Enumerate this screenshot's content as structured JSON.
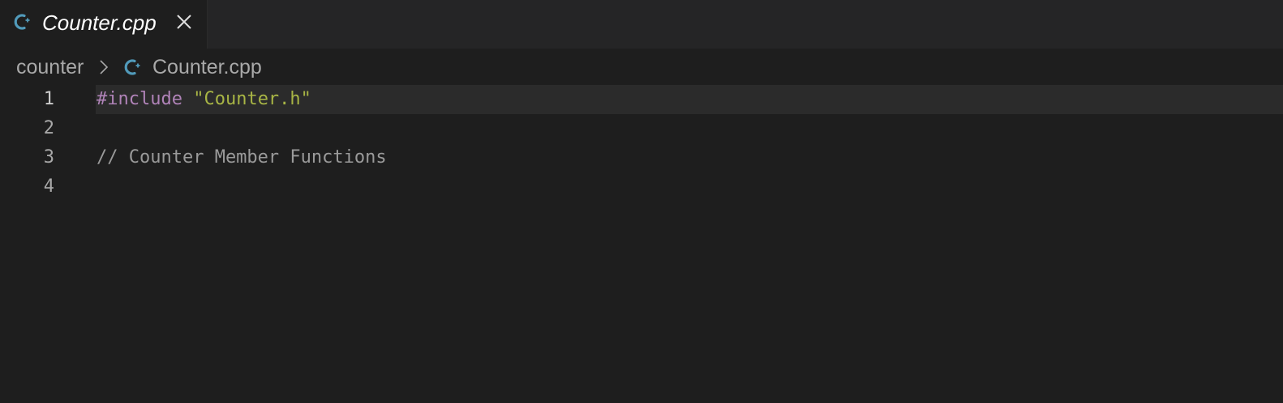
{
  "tab": {
    "label": "Counter.cpp",
    "icon": "cpp-file-icon",
    "close_icon": "close-icon"
  },
  "breadcrumb": {
    "folder": "counter",
    "separator_icon": "chevron-right-icon",
    "file": "Counter.cpp",
    "file_icon": "cpp-file-icon"
  },
  "editor": {
    "lines": [
      {
        "number": "1",
        "directive": "#include",
        "string": "\"Counter.h\""
      },
      {
        "number": "2"
      },
      {
        "number": "3",
        "comment": "// Counter Member Functions"
      },
      {
        "number": "4"
      }
    ]
  },
  "colors": {
    "background": "#1e1e1e",
    "tabbar": "#252526",
    "icon_blue": "#519aba",
    "directive": "#b083b8",
    "string": "#a8b545",
    "comment": "#9a9a9a"
  }
}
